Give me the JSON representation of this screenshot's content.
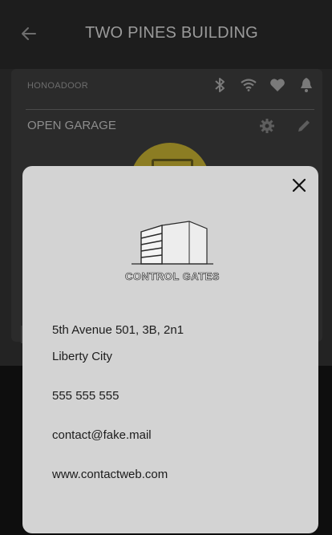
{
  "header": {
    "title": "TWO PINES BUILDING",
    "back_icon": "arrow-left-icon"
  },
  "device": {
    "name": "HONOADOOR",
    "status_icons": [
      "bluetooth-icon",
      "wifi-icon",
      "heart-icon",
      "bell-icon"
    ],
    "action_label": "OPEN GARAGE",
    "action_icons": [
      "gear-icon",
      "pencil-icon"
    ],
    "accent_color": "#8c7d23"
  },
  "modal": {
    "close_icon": "close-icon",
    "logo_text": "CONTROL GATES",
    "address_line1": "5th Avenue 501, 3B, 2n1",
    "address_line2": "Liberty City",
    "phone": "555 555 555",
    "email": "contact@fake.mail",
    "website": "www.contactweb.com"
  }
}
